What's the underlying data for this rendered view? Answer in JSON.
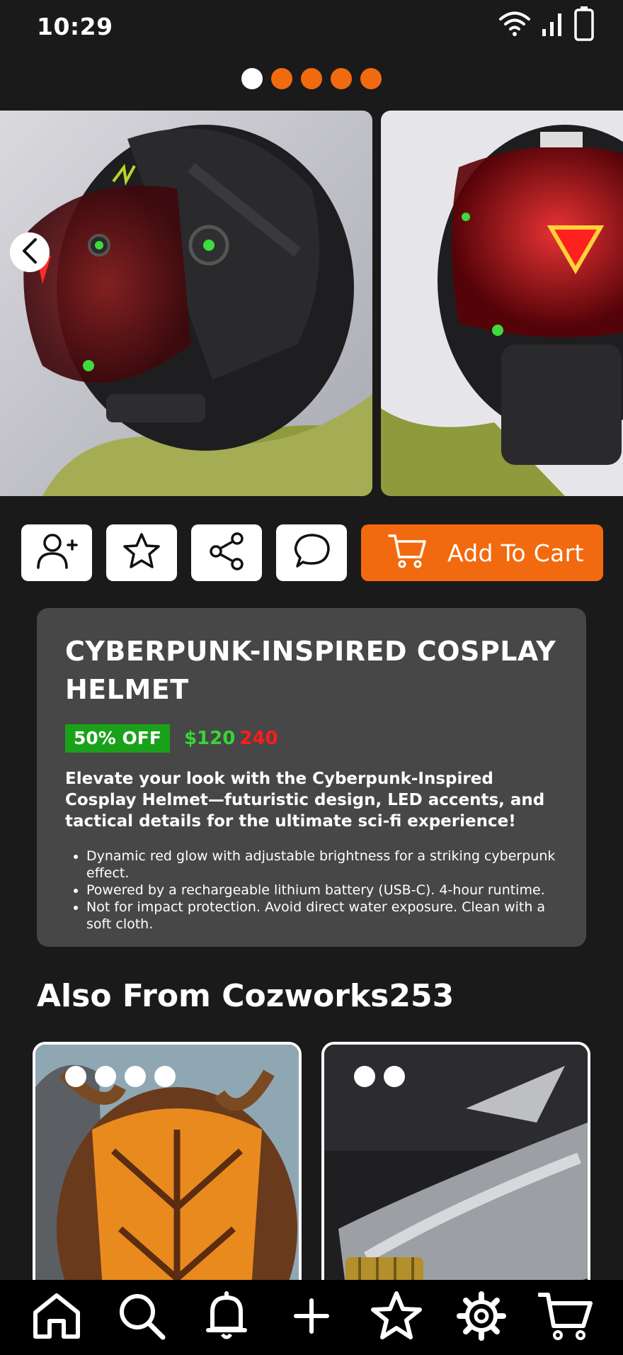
{
  "status": {
    "time": "10:29"
  },
  "gallery": {
    "total_images": 5,
    "active_index": 0,
    "dot_colors": {
      "active": "#ffffff",
      "inactive": "#f26a0f"
    }
  },
  "actions": {
    "follow_icon": "add-user-icon",
    "favorite_icon": "star-icon",
    "share_icon": "share-icon",
    "message_icon": "chat-bubble-icon",
    "cart_label": "Add To Cart"
  },
  "product": {
    "title": "CYBERPUNK-INSPIRED COSPLAY HELMET",
    "discount": "50% OFF",
    "sale_price": "$120",
    "original_price": "240",
    "description": "Elevate your look with the Cyberpunk-Inspired Cosplay Helmet—futuristic design, LED accents, and tactical details for the ultimate sci-fi experience!",
    "features": [
      "Dynamic red glow with adjustable brightness for a striking cyberpunk effect.",
      "Powered by a rechargeable lithium battery (USB-C). 4-hour runtime.",
      "Not for impact protection. Avoid direct water exposure. Clean with a soft cloth."
    ]
  },
  "also_from": {
    "title": "Also From Cozworks253",
    "cards": [
      {
        "image_count": 4
      },
      {
        "image_count": 2
      }
    ]
  },
  "nav": {
    "items": [
      "home-icon",
      "search-icon",
      "bell-icon",
      "plus-icon",
      "star-icon",
      "gear-icon",
      "cart-icon"
    ]
  },
  "colors": {
    "accent": "#f26a0f",
    "background": "#1a1a1a",
    "card": "#474747",
    "sale_green": "#35d635",
    "original_red": "#ff1c1c",
    "badge_green": "#1aa11a"
  }
}
